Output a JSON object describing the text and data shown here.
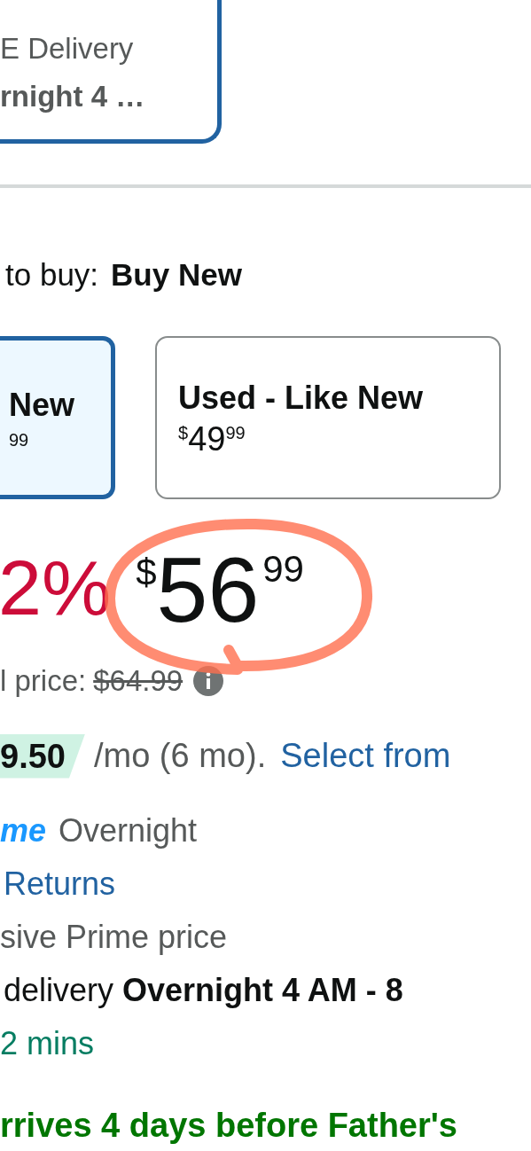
{
  "delivery_option": {
    "lines": [
      "E Delivery",
      "rnight 4 …"
    ],
    "selected": true
  },
  "buy_choice": {
    "label": "to buy:",
    "value": "Buy New"
  },
  "conditions": [
    {
      "title": "New",
      "price_cents": "99",
      "selected": true
    },
    {
      "title": "Used - Like New",
      "price_symbol": "$",
      "price_dollars": "49",
      "price_cents": "99",
      "selected": false
    }
  ],
  "price": {
    "discount": "2%",
    "symbol": "$",
    "dollars": "56",
    "cents": "99",
    "circled": true
  },
  "list_price": {
    "label": "l price:",
    "value": "$64.99"
  },
  "installment": {
    "amount": "9.50",
    "terms": "/mo (6 mo).",
    "link": "Select from"
  },
  "details": [
    {
      "kind": "prime",
      "badge": "me",
      "text": "Overnight"
    },
    {
      "kind": "link",
      "text": "Returns"
    },
    {
      "kind": "plain",
      "text": "sive Prime price"
    },
    {
      "kind": "plain",
      "text": "delivery **Overnight 4 AM - 8**"
    },
    {
      "kind": "countdown",
      "text": "2 mins"
    }
  ],
  "arrival_note": "rrives 4 days before Father's"
}
